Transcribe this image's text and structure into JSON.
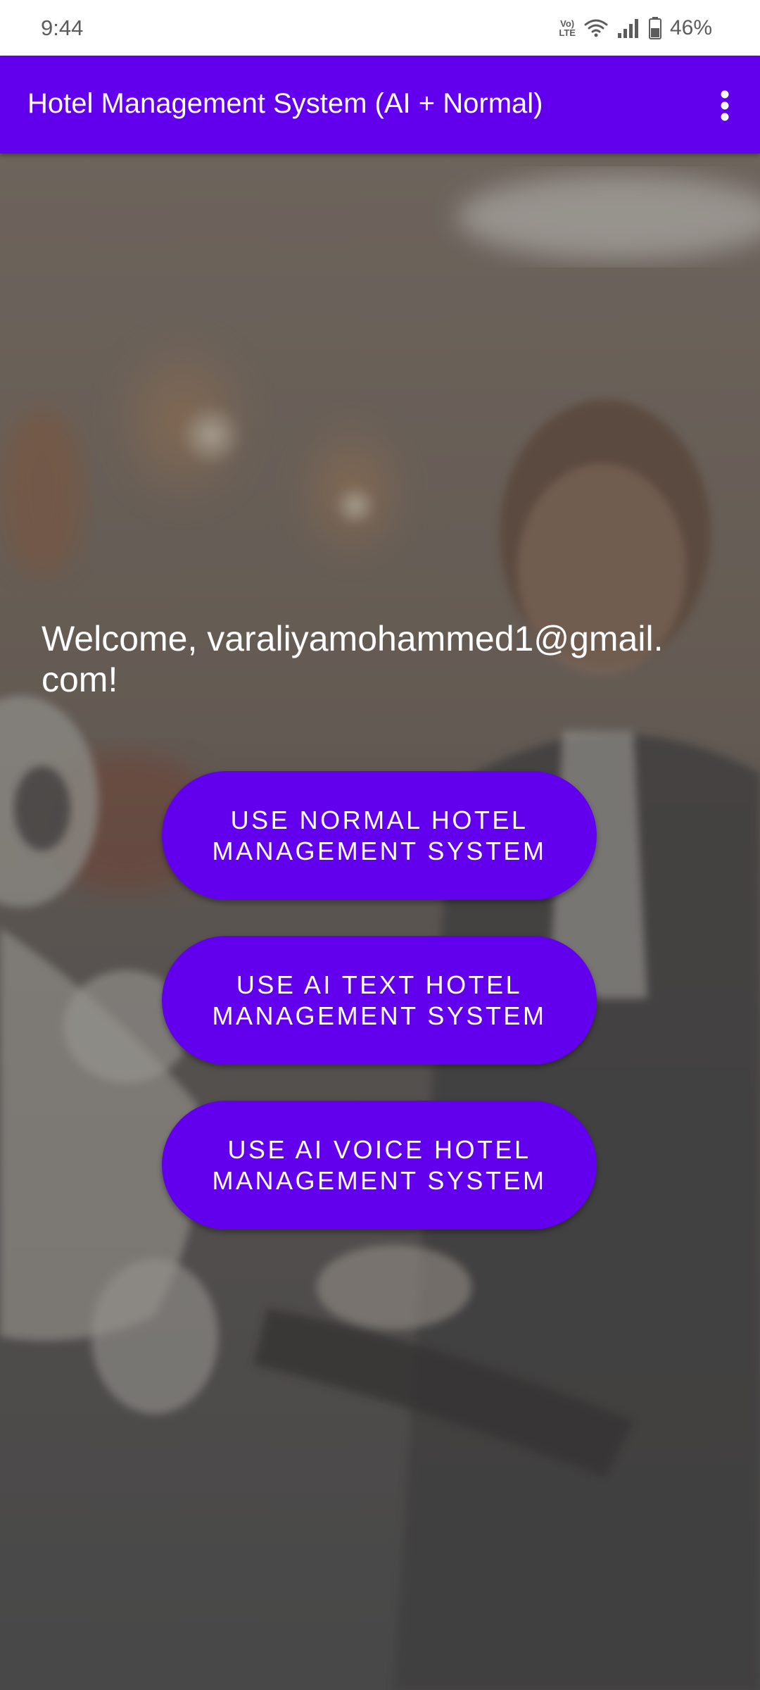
{
  "status_bar": {
    "time": "9:44",
    "volte_line1": "Vo)",
    "volte_line2": "LTE",
    "battery_percent": "46%",
    "icons": [
      "volte-icon",
      "wifi-icon",
      "signal-icon",
      "battery-icon"
    ]
  },
  "app_bar": {
    "title": "Hotel Management System (AI + Normal)",
    "menu_icon": "more-vert-icon"
  },
  "main": {
    "welcome_text": "Welcome, varaliyamohammed1@gmail.com!",
    "buttons": [
      {
        "label": "USE NORMAL HOTEL MANAGEMENT SYSTEM"
      },
      {
        "label": "USE AI TEXT HOTEL MANAGEMENT SYSTEM"
      },
      {
        "label": "USE AI VOICE HOTEL MANAGEMENT SYSTEM"
      }
    ]
  },
  "colors": {
    "primary": "#6200ee",
    "on_primary": "#ffffff",
    "status_bar_bg": "#ffffff",
    "status_text": "#5c5c5c"
  }
}
